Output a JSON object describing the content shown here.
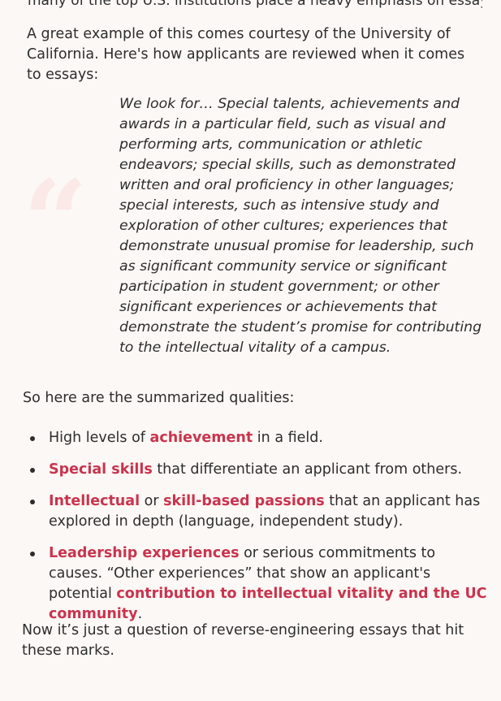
{
  "top_partial": "many of the top U.S. institutions place a heavy emphasis on essays' contribution",
  "intro": "A great example of this comes courtesy of the University of California. Here's how applicants are reviewed when it comes to essays:",
  "quote_glyph": "“",
  "quote": "We look for… Special talents, achievements and awards in a particular field, such as visual and performing arts, communication or athletic endeavors; special skills, such as demonstrated written and oral proficiency in other languages; special interests, such as intensive study and exploration of other cultures; experiences that demonstrate unusual promise for leadership, such as significant community service or significant participation in student government; or other significant experiences or achievements that demonstrate the student’s promise for contributing to the intellectual vitality of a campus.",
  "summary_intro": "So here are the summarized qualities:",
  "bullets": {
    "b1": {
      "pre": "High levels of ",
      "hl": "achievement",
      "post": " in a field."
    },
    "b2": {
      "hl": "Special skills",
      "post": " that differentiate an applicant from others."
    },
    "b3": {
      "hl1": "Intellectual",
      "mid": " or ",
      "hl2": "skill-based passions",
      "post": " that an applicant has explored in depth (language, independent study)."
    },
    "b4": {
      "hl1": "Leadership experiences",
      "mid": " or serious commitments to causes. “Other experiences” that show an applicant's potential ",
      "hl2": "contribution to intellectual vitality and the UC community",
      "post": "."
    }
  },
  "outro": "Now it’s just a question of reverse-engineering essays that hit these marks.",
  "colors": {
    "highlight": "#c9344e",
    "background": "#fcf8f5",
    "quote_mark": "#fbe9e7"
  }
}
